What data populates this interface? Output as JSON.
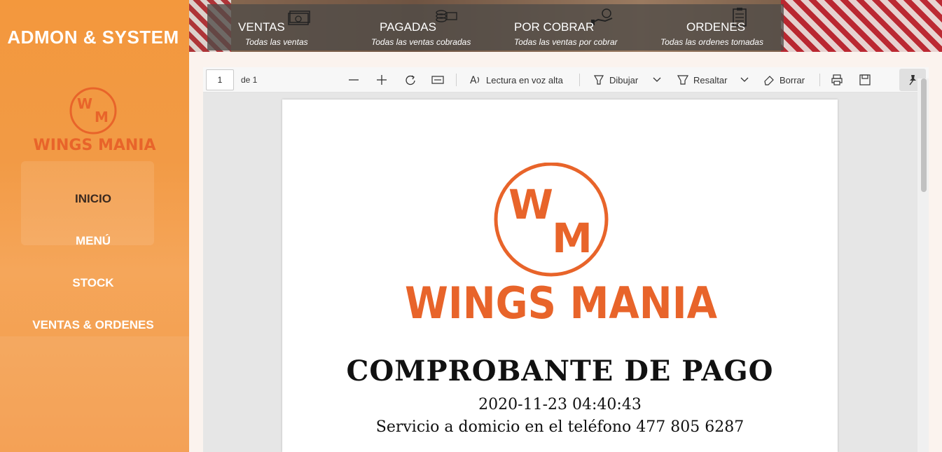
{
  "sidebar": {
    "brand": "ADMON & SYSTEM",
    "logo_text": "WINGS MANIA",
    "logo_initials": "WM",
    "items": [
      {
        "label": "INICIO"
      },
      {
        "label": "MENÚ"
      },
      {
        "label": "STOCK"
      },
      {
        "label": "VENTAS & ORDENES"
      }
    ]
  },
  "banner": {
    "stats": [
      {
        "title": "VENTAS",
        "subtitle": "Todas las ventas",
        "icon": "cash-icon"
      },
      {
        "title": "PAGADAS",
        "subtitle": "Todas las ventas cobradas",
        "icon": "coins-icon"
      },
      {
        "title": "POR COBRAR",
        "subtitle": "Todas las ventas por cobrar",
        "icon": "hand-coin-icon"
      },
      {
        "title": "ORDENES",
        "subtitle": "Todas las ordenes tomadas",
        "icon": "clipboard-icon"
      }
    ]
  },
  "viewer": {
    "page_number": "1",
    "page_of": "de 1",
    "read_aloud": "Lectura en voz alta",
    "draw": "Dibujar",
    "highlight": "Resaltar",
    "erase": "Borrar",
    "document": {
      "logo_text": "WINGS MANIA",
      "logo_initials": "WM",
      "title": "COMPROBANTE DE PAGO",
      "datetime": "2020-11-23 04:40:43",
      "service": "Servicio a domicio en el teléfono 477 805 6287"
    }
  },
  "colors": {
    "sidebar": "#f3983d",
    "brand_orange": "#e8642a",
    "stat_bar": "#504c48"
  }
}
